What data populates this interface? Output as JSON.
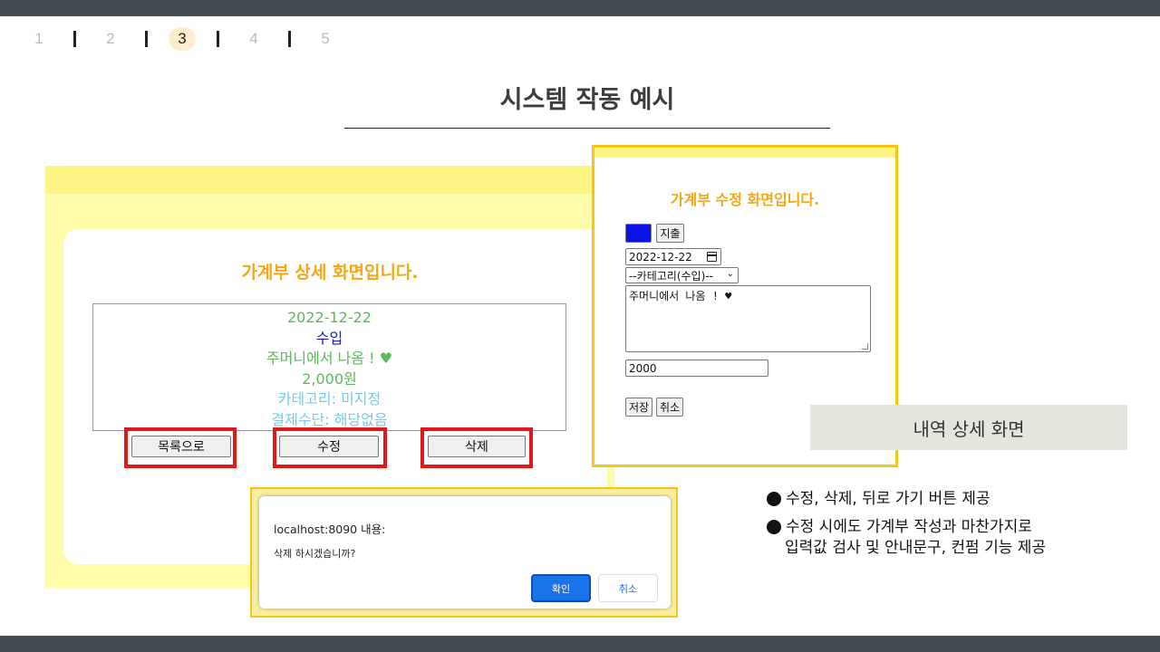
{
  "pagination": {
    "pages": [
      "1",
      "2",
      "3",
      "4",
      "5"
    ],
    "current": "3"
  },
  "slide": {
    "title": "시스템 작동 예시",
    "label": "내역 상세 화면",
    "bullets": [
      "수정, 삭제, 뒤로 가기 버튼 제공",
      "수정 시에도 가계부 작성과 마찬가지로",
      "입력값 검사 및 안내문구, 컨펌 기능 제공"
    ]
  },
  "detail_screen": {
    "heading": "가계부 상세 화면입니다.",
    "date": "2022-12-22",
    "type": "수입",
    "memo": "주머니에서 나옴 !",
    "heart": "♥",
    "amount": "2,000원",
    "category": "카테고리: 미지정",
    "payment": "결제수단: 해당없음",
    "buttons": {
      "list": "목록으로",
      "edit": "수정",
      "delete": "삭제"
    }
  },
  "edit_screen": {
    "heading": "가계부 수정 화면입니다.",
    "type_income": "수입",
    "type_expense": "지출",
    "date_value": "2022-12-22",
    "category_selected": "--카테고리(수입)--",
    "memo_value": "주머니에서 나옴 ! ♥",
    "amount_value": "2000",
    "buttons": {
      "save": "저장",
      "cancel": "취소"
    }
  },
  "confirm_dialog": {
    "origin": "localhost:8090 내용:",
    "message": "삭제 하시겠습니까?",
    "ok": "확인",
    "cancel": "취소"
  },
  "colors": {
    "heading_orange": "#f3a712",
    "highlight_red": "#e01818",
    "frame_yellow": "#f5c518",
    "dialog_blue": "#1a73e8",
    "topbar": "#434a54"
  }
}
